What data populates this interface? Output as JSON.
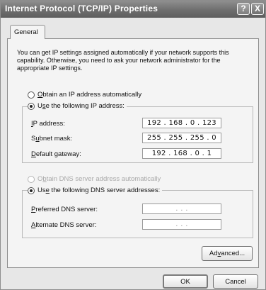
{
  "window": {
    "title": "Internet Protocol (TCP/IP) Properties",
    "help_glyph": "?",
    "close_glyph": "X"
  },
  "tabs": [
    {
      "label": "General",
      "selected": true
    }
  ],
  "description": "You can get IP settings assigned automatically if your network supports this capability. Otherwise, you need to ask your network administrator for the appropriate IP settings.",
  "ip": {
    "auto": {
      "mnemonic": "O",
      "rest": "btain an IP address automatically",
      "checked": false
    },
    "manual": {
      "pre": "U",
      "mnemonic": "s",
      "rest": "e the following IP address:",
      "checked": true
    },
    "fields": [
      {
        "pre": "",
        "mnemonic": "I",
        "rest": "P address:",
        "value": "192 . 168 .  0  . 123"
      },
      {
        "pre": "S",
        "mnemonic": "u",
        "rest": "bnet mask:",
        "value": "255 . 255 . 255 .  0"
      },
      {
        "pre": "",
        "mnemonic": "D",
        "rest": "efault gateway:",
        "value": "192 . 168 .  0  .  1"
      }
    ]
  },
  "dns": {
    "auto": {
      "pre": "O",
      "mnemonic": "b",
      "rest": "tain DNS server address automatically",
      "checked": false,
      "enabled": false
    },
    "manual": {
      "pre": "Us",
      "mnemonic": "e",
      "rest": " the following DNS server addresses:",
      "checked": true
    },
    "fields": [
      {
        "pre": "",
        "mnemonic": "P",
        "rest": "referred DNS server:",
        "value": ".      .      ."
      },
      {
        "pre": "",
        "mnemonic": "A",
        "rest": "lternate DNS server:",
        "value": ".      .      ."
      }
    ]
  },
  "buttons": {
    "advanced": {
      "pre": "Ad",
      "mnemonic": "v",
      "rest": "anced..."
    },
    "ok": "OK",
    "cancel": "Cancel"
  }
}
